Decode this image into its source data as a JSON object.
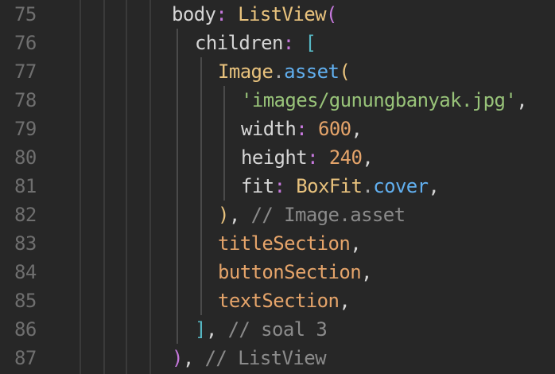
{
  "lines": [
    {
      "no": "75",
      "parts": [
        [
          "prop",
          "body"
        ],
        [
          "colon",
          ":"
        ],
        [
          "prop",
          " "
        ],
        [
          "cls",
          "ListView"
        ],
        [
          "paren2",
          "("
        ]
      ]
    },
    {
      "no": "76",
      "parts": [
        [
          "prop",
          "children"
        ],
        [
          "colon",
          ":"
        ],
        [
          "prop",
          " "
        ],
        [
          "brk",
          "["
        ]
      ]
    },
    {
      "no": "77",
      "parts": [
        [
          "cls",
          "Image"
        ],
        [
          "punc",
          "."
        ],
        [
          "meth",
          "asset"
        ],
        [
          "paren",
          "("
        ]
      ]
    },
    {
      "no": "78",
      "parts": [
        [
          "str",
          "'images/gunungbanyak.jpg'"
        ],
        [
          "comma",
          ","
        ]
      ]
    },
    {
      "no": "79",
      "parts": [
        [
          "prop",
          "width"
        ],
        [
          "colon",
          ":"
        ],
        [
          "prop",
          " "
        ],
        [
          "num",
          "600"
        ],
        [
          "comma",
          ","
        ]
      ]
    },
    {
      "no": "80",
      "parts": [
        [
          "prop",
          "height"
        ],
        [
          "colon",
          ":"
        ],
        [
          "prop",
          " "
        ],
        [
          "num",
          "240"
        ],
        [
          "comma",
          ","
        ]
      ]
    },
    {
      "no": "81",
      "parts": [
        [
          "prop",
          "fit"
        ],
        [
          "colon",
          ":"
        ],
        [
          "prop",
          " "
        ],
        [
          "cls",
          "BoxFit"
        ],
        [
          "punc",
          "."
        ],
        [
          "meth",
          "cover"
        ],
        [
          "comma",
          ","
        ]
      ]
    },
    {
      "no": "82",
      "parts": [
        [
          "paren",
          ")"
        ],
        [
          "comma",
          ","
        ],
        [
          "prop",
          " "
        ],
        [
          "com",
          "// Image.asset"
        ]
      ]
    },
    {
      "no": "83",
      "parts": [
        [
          "ident",
          "titleSection"
        ],
        [
          "comma",
          ","
        ]
      ]
    },
    {
      "no": "84",
      "parts": [
        [
          "ident",
          "buttonSection"
        ],
        [
          "comma",
          ","
        ]
      ]
    },
    {
      "no": "85",
      "parts": [
        [
          "ident",
          "textSection"
        ],
        [
          "comma",
          ","
        ]
      ]
    },
    {
      "no": "86",
      "parts": [
        [
          "brk",
          "]"
        ],
        [
          "comma",
          ","
        ],
        [
          "prop",
          " "
        ],
        [
          "com",
          "// soal 3"
        ]
      ]
    },
    {
      "no": "87",
      "parts": [
        [
          "paren2",
          ")"
        ],
        [
          "comma",
          ","
        ],
        [
          "prop",
          " "
        ],
        [
          "com",
          "// ListView"
        ]
      ]
    }
  ]
}
